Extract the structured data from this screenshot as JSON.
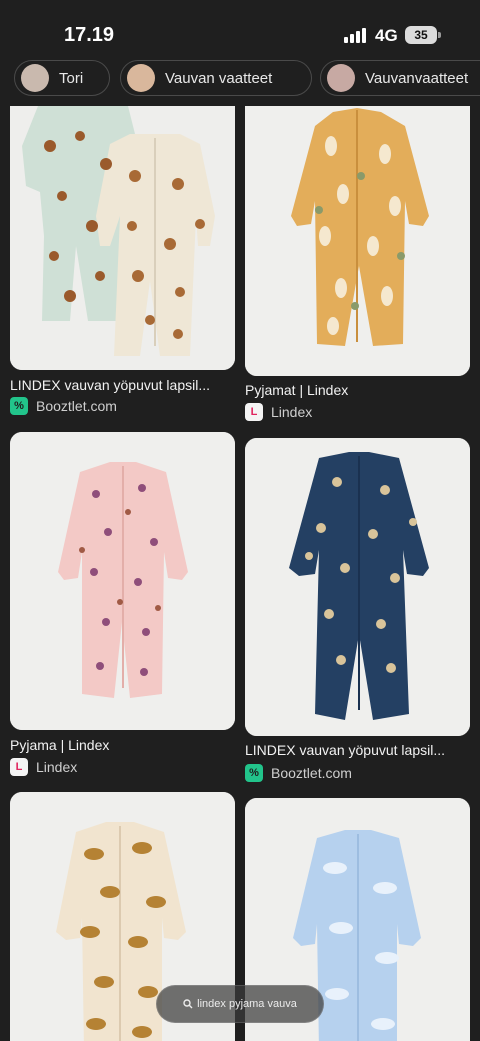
{
  "status_bar": {
    "time": "17.19",
    "network": "4G",
    "battery": "35"
  },
  "chips": [
    {
      "label": "Tori"
    },
    {
      "label": "Vauvan vaatteet"
    },
    {
      "label": "Vauvanvaatteet"
    }
  ],
  "results": [
    {
      "title": "LINDEX vauvan yöpuvut lapsil...",
      "source": "Booztlet.com",
      "favicon": "booztlet-icon"
    },
    {
      "title": "Pyjamat | Lindex",
      "source": "Lindex",
      "favicon": "lindex-icon"
    },
    {
      "title": "Pyjama | Lindex",
      "source": "Lindex",
      "favicon": "lindex-icon"
    },
    {
      "title": "LINDEX vauvan yöpuvut lapsil...",
      "source": "Booztlet.com",
      "favicon": "booztlet-icon"
    },
    {
      "title": "",
      "source": "",
      "favicon": ""
    },
    {
      "title": "",
      "source": "",
      "favicon": ""
    }
  ],
  "search_pill": {
    "query": "lindex pyjama vauva"
  },
  "colors": {
    "background": "#1f1f1f",
    "booztlet": "#22c48b",
    "lindex": "#e0245e",
    "suit_mint": "#cfe0d6",
    "suit_cream": "#efe7d6",
    "suit_mustard": "#e3ad5a",
    "suit_pink": "#f3c9c6",
    "suit_navy": "#244063",
    "suit_beige": "#f1e4cf",
    "suit_lightblue": "#b6d1ee"
  }
}
